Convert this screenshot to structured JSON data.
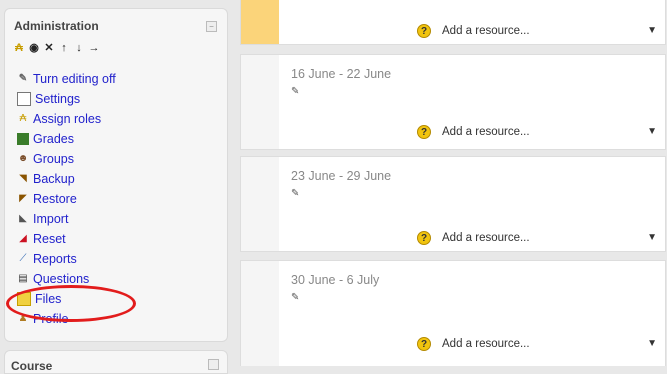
{
  "admin": {
    "title": "Administration",
    "menu": [
      {
        "label": "Turn editing off",
        "icon": "edit-toggle-icon"
      },
      {
        "label": "Settings",
        "icon": "settings-icon"
      },
      {
        "label": "Assign roles",
        "icon": "roles-icon"
      },
      {
        "label": "Grades",
        "icon": "grades-icon"
      },
      {
        "label": "Groups",
        "icon": "groups-icon"
      },
      {
        "label": "Backup",
        "icon": "backup-icon"
      },
      {
        "label": "Restore",
        "icon": "restore-icon"
      },
      {
        "label": "Import",
        "icon": "import-icon"
      },
      {
        "label": "Reset",
        "icon": "reset-icon"
      },
      {
        "label": "Reports",
        "icon": "reports-icon"
      },
      {
        "label": "Questions",
        "icon": "questions-icon"
      },
      {
        "label": "Files",
        "icon": "files-icon"
      },
      {
        "label": "Profile",
        "icon": "profile-icon"
      }
    ]
  },
  "course_block": {
    "title": "Course"
  },
  "weeks": [
    {
      "title": "",
      "add_resource": "Add a resource..."
    },
    {
      "title": "16 June - 22 June",
      "add_resource": "Add a resource..."
    },
    {
      "title": "23 June - 29 June",
      "add_resource": "Add a resource..."
    },
    {
      "title": "30 June - 6 July",
      "add_resource": "Add a resource..."
    }
  ],
  "colors": {
    "highlight": "#e21c1c",
    "link": "#2222cc"
  }
}
